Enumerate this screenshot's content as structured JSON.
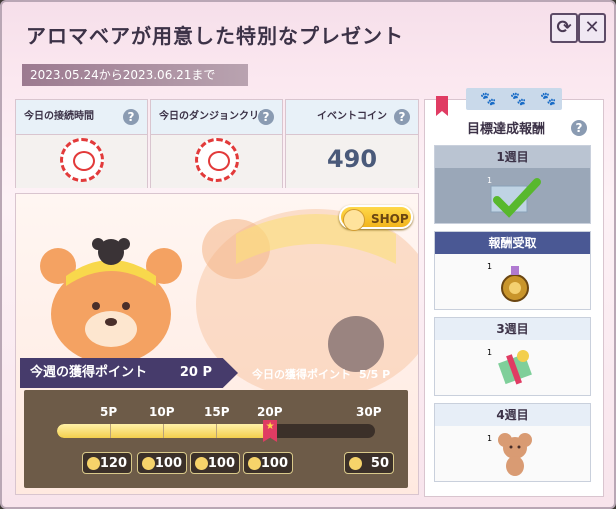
{
  "window": {
    "title": "アロマベアが用意した特別なプレゼント",
    "date_range": "2023.05.24から2023.06.21まで"
  },
  "stats": [
    {
      "label": "今日の接続時間",
      "type": "stamp"
    },
    {
      "label": "今日のダンジョンクリア",
      "type": "stamp"
    },
    {
      "label": "イベントコイン",
      "value": "490"
    }
  ],
  "shop": {
    "label": "SHOP"
  },
  "points": {
    "weekly_label": "今週の獲得ポイント",
    "weekly_value": "20 P",
    "today_label": "今日の獲得ポイント",
    "today_value": "5/5 P",
    "progress_fraction": 0.67,
    "ticks": [
      "5P",
      "10P",
      "15P",
      "20P",
      "30P"
    ],
    "rewards": [
      "120",
      "100",
      "100",
      "100",
      "50"
    ]
  },
  "goal_rewards": {
    "title": "目標達成報酬",
    "weeks": [
      {
        "label": "1週目",
        "qty": "1",
        "state": "completed"
      },
      {
        "label": "報酬受取",
        "qty": "1",
        "state": "claimable"
      },
      {
        "label": "3週目",
        "qty": "1",
        "state": "locked"
      },
      {
        "label": "4週目",
        "qty": "1",
        "state": "locked"
      }
    ]
  },
  "colors": {
    "accent": "#463b6b",
    "coin": "#4a5a7a",
    "progress": "#f3cf4d",
    "check": "#58b82d"
  },
  "icons": [
    "refresh-icon",
    "close-icon",
    "help-icon",
    "stamp-icon",
    "shop-coin-icon",
    "star-marker-icon",
    "checkmark-icon",
    "gift-icon",
    "paw-icon"
  ]
}
